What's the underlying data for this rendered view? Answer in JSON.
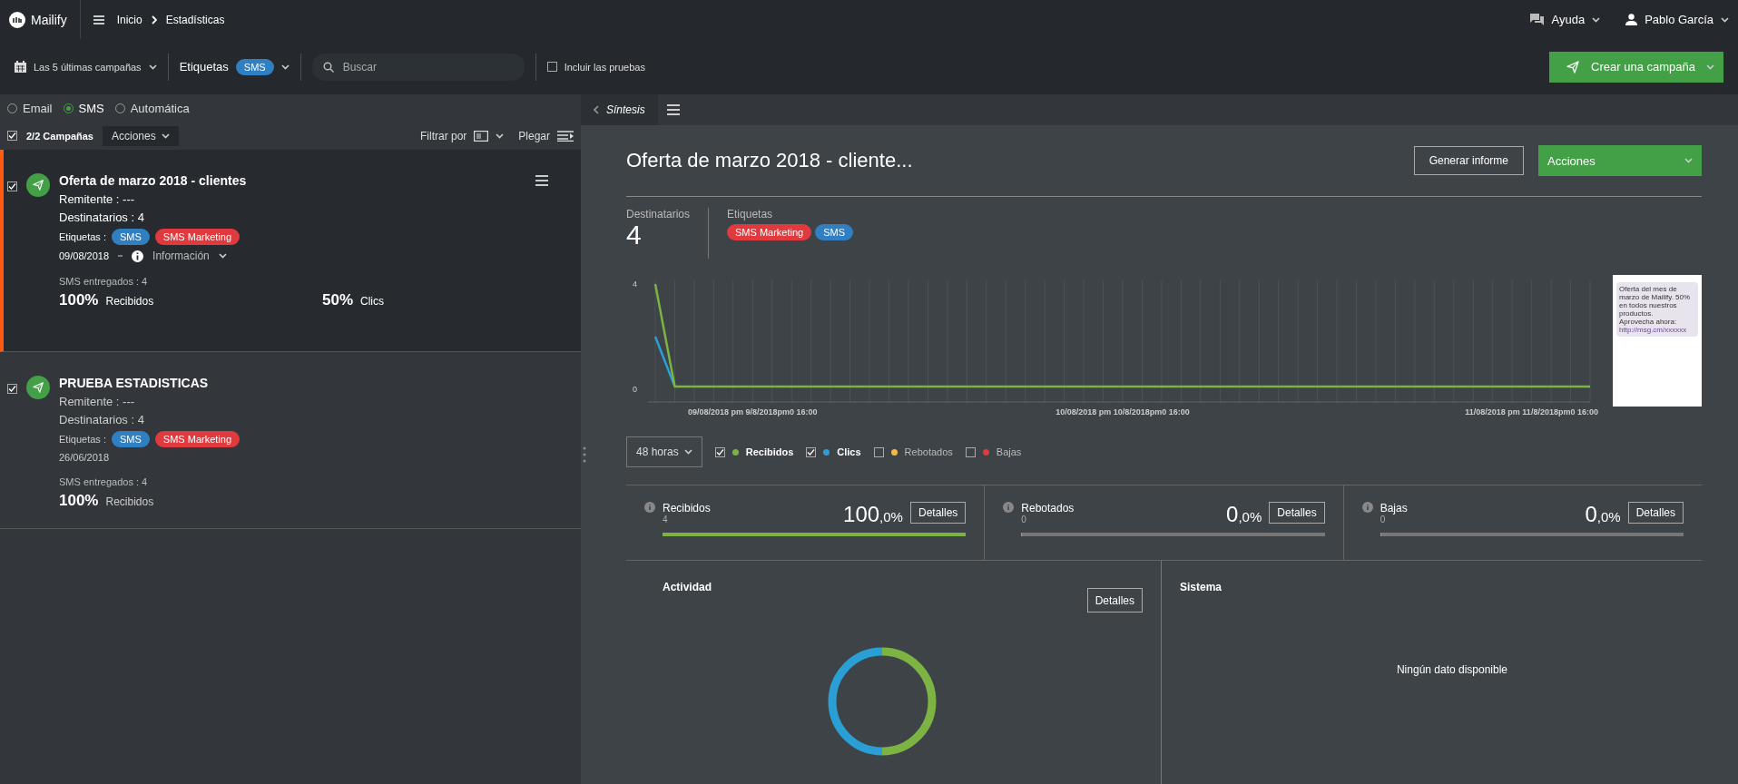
{
  "topbar": {
    "logo": "Mailify",
    "breadcrumb": [
      "Inicio",
      "Estadísticas"
    ],
    "help": "Ayuda",
    "user": "Pablo García"
  },
  "filters": {
    "period": "Las 5 últimas campañas",
    "tags_label": "Etiquetas",
    "tags": [
      {
        "label": "SMS",
        "color": "#2f7fc1"
      }
    ],
    "search": {
      "placeholder": "Buscar"
    },
    "include_tests": {
      "label": "Incluir las pruebas",
      "checked": false
    },
    "create_button": "Crear una campaña"
  },
  "left": {
    "channels": [
      {
        "label": "Email",
        "selected": false
      },
      {
        "label": "SMS",
        "selected": true
      },
      {
        "label": "Automática",
        "selected": false
      }
    ],
    "select_all": {
      "label": "2/2 Campañas",
      "checked": true
    },
    "actions": "Acciones",
    "filter": "Filtrar por",
    "collapse": "Plegar",
    "campaigns": [
      {
        "title": "Oferta de marzo 2018 - clientes",
        "selected": true,
        "checked": true,
        "sender": "Remitente : ---",
        "recipients": "Destinatarios : 4",
        "tags_label": "Etiquetas :",
        "tags": [
          {
            "label": "SMS",
            "color": "#2f7fc1"
          },
          {
            "label": "SMS Marketing",
            "color": "#e0393e"
          }
        ],
        "date": "09/08/2018",
        "info": "Información",
        "delivered": "SMS entregados : 4",
        "stats": [
          {
            "value": "100%",
            "label": "Recibidos"
          },
          {
            "value": "50%",
            "label": "Clics"
          }
        ]
      },
      {
        "title": "PRUEBA ESTADISTICAS",
        "selected": false,
        "checked": true,
        "sender": "Remitente : ---",
        "recipients": "Destinatarios : 4",
        "tags_label": "Etiquetas :",
        "tags": [
          {
            "label": "SMS",
            "color": "#2f7fc1"
          },
          {
            "label": "SMS Marketing",
            "color": "#e0393e"
          }
        ],
        "date": "26/06/2018",
        "delivered": "SMS entregados : 4",
        "stats": [
          {
            "value": "100%",
            "label": "Recibidos"
          }
        ]
      }
    ]
  },
  "detail": {
    "tab": "Síntesis",
    "title": "Oferta de marzo 2018 - cliente...",
    "report_button": "Generar informe",
    "actions_button": "Acciones",
    "recipients_label": "Destinatarios",
    "recipients": "4",
    "tags_label": "Etiquetas",
    "tags": [
      {
        "label": "SMS Marketing",
        "color": "#e0393e"
      },
      {
        "label": "SMS",
        "color": "#2f7fc1"
      }
    ],
    "chart_data": {
      "type": "line",
      "grid": true,
      "categories": [
        null,
        null,
        null,
        null,
        null,
        "09/08/2018 pm 9/8/2018pm0 16:00",
        null,
        null,
        null,
        null,
        null,
        null,
        null,
        null,
        null,
        null,
        null,
        null,
        null,
        null,
        null,
        null,
        null,
        null,
        "10/08/2018 pm 10/8/2018pm0 16:00",
        null,
        null,
        null,
        null,
        null,
        null,
        null,
        null,
        null,
        null,
        null,
        null,
        null,
        null,
        null,
        null,
        null,
        null,
        null,
        null,
        "11/08/2018 pm 11/8/2018pm0 16:00",
        null,
        null,
        null
      ],
      "series": [
        {
          "name": "Recibidos",
          "color": "#7cb342",
          "values": [
            4,
            0,
            0,
            0,
            0,
            0,
            0,
            0,
            0,
            0,
            0,
            0,
            0,
            0,
            0,
            0,
            0,
            0,
            0,
            0,
            0,
            0,
            0,
            0,
            0,
            0,
            0,
            0,
            0,
            0,
            0,
            0,
            0,
            0,
            0,
            0,
            0,
            0,
            0,
            0,
            0,
            0,
            0,
            0,
            0,
            0,
            0,
            0,
            0
          ]
        },
        {
          "name": "Clics",
          "color": "#2a9fd6",
          "values": [
            2,
            0,
            null,
            null,
            null,
            null,
            null,
            null,
            null,
            null,
            null,
            null,
            null,
            null,
            null,
            null,
            null,
            null,
            null,
            null,
            null,
            null,
            null,
            null,
            null,
            null,
            null,
            null,
            null,
            null,
            null,
            null,
            null,
            null,
            null,
            null,
            null,
            null,
            null,
            null,
            null,
            null,
            null,
            null,
            null,
            null,
            null,
            null,
            null
          ]
        }
      ],
      "ylim": [
        0,
        4
      ],
      "yticks": [
        0,
        4
      ]
    },
    "sms_preview": {
      "text": "Oferta del mes de marzo de Mailify. 50% en todos nuestros productos.",
      "cta": "Aprovecha ahora:",
      "link": "http://msg.cm/xxxxxx"
    },
    "range": "48 horas",
    "legend": [
      {
        "checked": true
      },
      {
        "checked": true
      },
      {
        "label": "Rebotados",
        "color": "#f5b942",
        "checked": false
      },
      {
        "label": "Bajas",
        "color": "#e0393e",
        "checked": false
      }
    ],
    "stats": [
      {
        "label": "Recibidos",
        "count": "4",
        "value": "100",
        "decimal": ",0%",
        "level": 1,
        "button": "Detalles"
      },
      {
        "label": "Rebotados",
        "count": "0",
        "value": "0",
        "decimal": ",0%",
        "level": 0,
        "button": "Detalles"
      },
      {
        "label": "Bajas",
        "count": "0",
        "value": "0",
        "decimal": ",0%",
        "level": 0,
        "button": "Detalles"
      }
    ],
    "activity": {
      "title": "Actividad",
      "button": "Detalles"
    },
    "system": {
      "title": "Sistema",
      "empty": "Ningún dato disponible"
    }
  }
}
